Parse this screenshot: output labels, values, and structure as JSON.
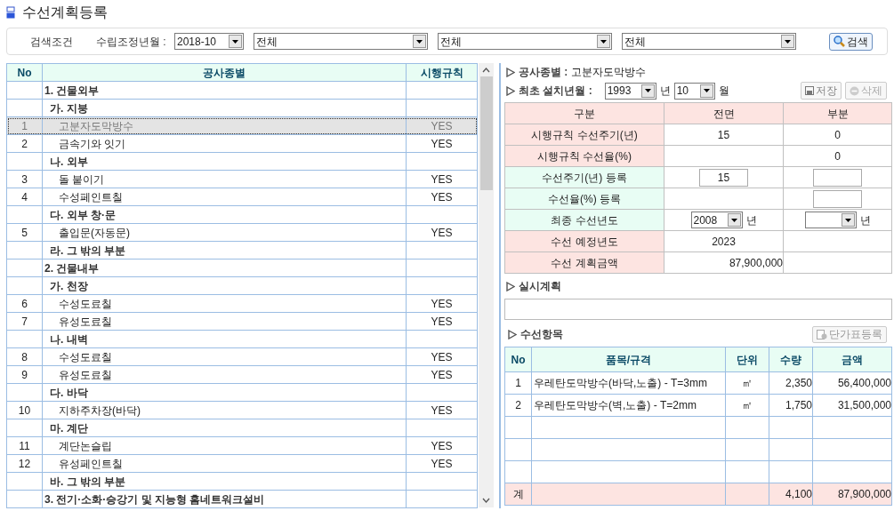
{
  "page_title": "수선계획등록",
  "search": {
    "label": "검색조건",
    "period_label": "수립조정년월 :",
    "period_value": "2018-10",
    "filters": [
      "전체",
      "전체",
      "전체"
    ],
    "button": "검색"
  },
  "work_table": {
    "columns": [
      "No",
      "공사종별",
      "시행규칙"
    ],
    "sections": [
      {
        "title": "1. 건물외부",
        "children": [
          {
            "title": "가. 지붕",
            "children": [
              {
                "no": "1",
                "name": "고분자도막방수",
                "rule": "YES",
                "selected": true
              },
              {
                "no": "2",
                "name": "금속기와 잇기",
                "rule": "YES",
                "selected": false
              }
            ]
          },
          {
            "title": "나. 외부",
            "children": [
              {
                "no": "3",
                "name": "돌 붙이기",
                "rule": "YES",
                "selected": false
              },
              {
                "no": "4",
                "name": "수성페인트칠",
                "rule": "YES",
                "selected": false
              }
            ]
          },
          {
            "title": "다. 외부 창·문",
            "children": [
              {
                "no": "5",
                "name": "출입문(자동문)",
                "rule": "YES",
                "selected": false
              }
            ]
          },
          {
            "title": "라. 그 밖의 부분"
          }
        ]
      },
      {
        "title": "2. 건물내부",
        "children": [
          {
            "title": "가. 천장",
            "children": [
              {
                "no": "6",
                "name": "수성도료칠",
                "rule": "YES",
                "selected": false
              },
              {
                "no": "7",
                "name": "유성도료칠",
                "rule": "YES",
                "selected": false
              }
            ]
          },
          {
            "title": "나. 내벽",
            "children": [
              {
                "no": "8",
                "name": "수성도료칠",
                "rule": "YES",
                "selected": false
              },
              {
                "no": "9",
                "name": "유성도료칠",
                "rule": "YES",
                "selected": false
              }
            ]
          },
          {
            "title": "다. 바닥",
            "children": [
              {
                "no": "10",
                "name": "지하주차장(바닥)",
                "rule": "YES",
                "selected": false
              }
            ]
          },
          {
            "title": "마. 계단",
            "children": [
              {
                "no": "11",
                "name": "계단논슬립",
                "rule": "YES",
                "selected": false
              },
              {
                "no": "12",
                "name": "유성페인트칠",
                "rule": "YES",
                "selected": false
              }
            ]
          },
          {
            "title": "바. 그 밖의 부분"
          }
        ]
      },
      {
        "title": "3. 전기·소화·승강기 및 지능형 홈네트워크설비"
      }
    ]
  },
  "detail": {
    "work_label": "공사종별 :",
    "work_value": "고분자도막방수",
    "install_label": "최초 설치년월 :",
    "install_year": "1993",
    "year_unit": "년",
    "install_month": "10",
    "month_unit": "월",
    "save_button": "저장",
    "delete_button": "삭제",
    "columns": [
      "구분",
      "전면",
      "부분"
    ],
    "rows": [
      {
        "kind": "rule",
        "cells": [
          {
            "kind": "label",
            "value": "시행규칙 수선주기(년)"
          },
          {
            "kind": "text",
            "value": "15"
          },
          {
            "kind": "text",
            "value": "0"
          }
        ]
      },
      {
        "kind": "rule",
        "cells": [
          {
            "kind": "label",
            "value": "시행규칙 수선율(%)"
          },
          {
            "kind": "empty"
          },
          {
            "kind": "text",
            "value": "0"
          }
        ]
      },
      {
        "kind": "entry",
        "cells": [
          {
            "kind": "label",
            "value": "수선주기(년) 등록"
          },
          {
            "kind": "input",
            "value": "15"
          },
          {
            "kind": "input"
          }
        ]
      },
      {
        "kind": "entry",
        "cells": [
          {
            "kind": "label",
            "value": "수선율(%) 등록"
          },
          {
            "kind": "empty"
          },
          {
            "kind": "input"
          }
        ]
      },
      {
        "kind": "entry",
        "cells": [
          {
            "kind": "label",
            "value": "최종 수선년도"
          },
          {
            "kind": "select",
            "value": "2008",
            "suffix": "년"
          },
          {
            "kind": "select",
            "suffix": "년"
          }
        ]
      },
      {
        "kind": "rule",
        "cells": [
          {
            "kind": "label",
            "value": "수선 예정년도"
          },
          {
            "kind": "text",
            "value": "2023"
          },
          {
            "kind": "empty"
          }
        ]
      },
      {
        "kind": "rule",
        "cells": [
          {
            "kind": "label",
            "value": "수선 계획금액"
          },
          {
            "kind": "amount",
            "value": "87,900,000"
          },
          {
            "kind": "empty"
          }
        ]
      }
    ]
  },
  "plan": {
    "title": "실시계획"
  },
  "items": {
    "title": "수선항목",
    "button": "단가표등록",
    "columns": [
      "No",
      "품목/규격",
      "단위",
      "수량",
      "금액"
    ],
    "rows": [
      {
        "no": "1",
        "name": "우레탄도막방수(바닥,노출) - T=3mm",
        "unit": "㎡",
        "qty": "2,350",
        "amount": "56,400,000"
      },
      {
        "no": "2",
        "name": "우레탄도막방수(벽,노출) - T=2mm",
        "unit": "㎡",
        "qty": "1,750",
        "amount": "31,500,000"
      }
    ],
    "total": {
      "label": "계",
      "qty": "4,100",
      "amount": "87,900,000"
    }
  }
}
